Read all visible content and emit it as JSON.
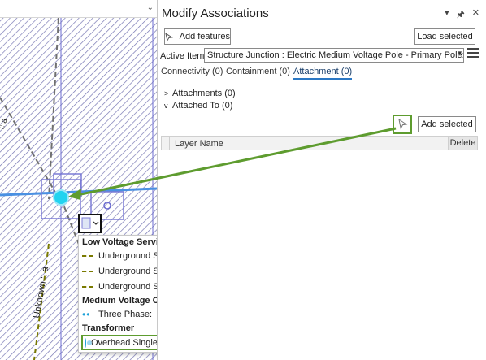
{
  "map": {
    "layer_label": "Unknown :: a",
    "small_label": ":: a"
  },
  "popup": {
    "sections": [
      {
        "header": "Low Voltage Service",
        "items": [
          "Underground Service LV:",
          "Underground Service LV:",
          "Underground Service LV:"
        ]
      },
      {
        "header": "Medium Voltage Connector",
        "items": [
          "Three Phase:"
        ]
      },
      {
        "header": "Transformer",
        "items": [
          "Overhead Single Phase - MV->LV:"
        ]
      }
    ]
  },
  "pane": {
    "title": "Modify Associations",
    "controls": {
      "menu": "▾",
      "pin": "🖈",
      "close": "✕"
    },
    "add_features_label": "Add features",
    "load_selected_label": "Load selected",
    "active_item_label": "Active Item:",
    "active_item_value": "Structure Junction : Electric Medium Voltage Pole - Primary Pole:",
    "tabs": [
      "Connectivity (0)",
      "Containment (0)",
      "Attachment (0)"
    ],
    "attachments_label": "Attachments (0)",
    "attached_to_label": "Attached To (0)",
    "add_selected_label": "Add selected",
    "table_columns": [
      "Layer Name",
      "Delete"
    ]
  },
  "colors": {
    "highlight_green": "#5e9c2f",
    "tab_underline": "#2b78c5",
    "feature_cyan": "#22d3f0",
    "selection_purple": "#7b7bd6"
  }
}
